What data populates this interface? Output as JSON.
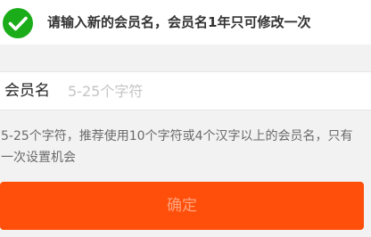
{
  "notice": {
    "icon": "check-circle-icon",
    "icon_color": "#1aad19",
    "text": "请输入新的会员名，会员名1年只可修改一次"
  },
  "form": {
    "label": "会员名",
    "value": "",
    "placeholder": "5-25个字符"
  },
  "hint": {
    "text": "5-25个字符，推荐使用10个字符或4个汉字以上的会员名，只有一次设置机会"
  },
  "confirm": {
    "label": "确定",
    "color": "#ff4f0a"
  }
}
